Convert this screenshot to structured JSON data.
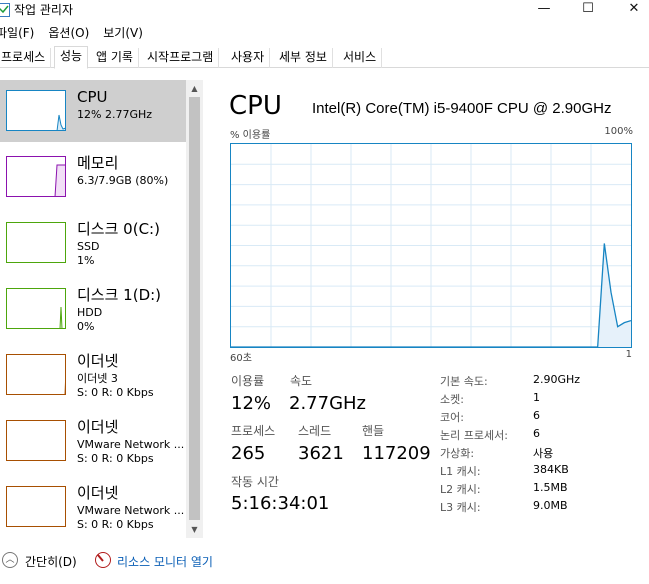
{
  "window": {
    "title": "작업 관리자",
    "minimize": "—",
    "maximize": "☐",
    "close": "✕"
  },
  "menu": [
    "파일(F)",
    "옵션(O)",
    "보기(V)"
  ],
  "tabs": [
    "프로세스",
    "성능",
    "앱 기록",
    "시작프로그램",
    "사용자",
    "세부 정보",
    "서비스"
  ],
  "active_tab": "성능",
  "sidebar": [
    {
      "title": "CPU",
      "lines": [
        "12% 2.77GHz"
      ],
      "color": "#1785c3"
    },
    {
      "title": "메모리",
      "lines": [
        "6.3/7.9GB (80%)"
      ],
      "color": "#8b12ae"
    },
    {
      "title": "디스크 0(C:)",
      "lines": [
        "SSD",
        "1%"
      ],
      "color": "#4da60c"
    },
    {
      "title": "디스크 1(D:)",
      "lines": [
        "HDD",
        "0%"
      ],
      "color": "#4da60c"
    },
    {
      "title": "이더넷",
      "lines": [
        "이더넷 3",
        "S: 0 R: 0 Kbps"
      ],
      "color": "#a74f01"
    },
    {
      "title": "이더넷",
      "lines": [
        "VMware Network ...",
        "S: 0 R: 0 Kbps"
      ],
      "color": "#a74f01"
    },
    {
      "title": "이더넷",
      "lines": [
        "VMware Network ...",
        "S: 0 R: 0 Kbps"
      ],
      "color": "#a74f01"
    }
  ],
  "main": {
    "title": "CPU",
    "model": "Intel(R) Core(TM) i5-9400F CPU @ 2.90GHz",
    "axis_top_left": "% 이용률",
    "axis_top_right": "100%",
    "axis_bottom_left": "60초",
    "axis_bottom_right": "1"
  },
  "chart_data": {
    "type": "area",
    "ylim": [
      0,
      100
    ],
    "x": [
      0,
      1,
      2,
      3,
      4,
      5,
      6,
      7,
      8,
      9,
      10,
      11,
      12,
      13,
      14,
      15,
      16,
      17,
      18,
      19,
      20,
      21,
      22,
      23,
      24,
      25,
      26,
      27,
      28,
      29,
      30,
      31,
      32,
      33,
      34,
      35,
      36,
      37,
      38,
      39,
      40,
      41,
      42,
      43,
      44,
      45,
      46,
      47,
      48,
      49,
      50,
      51,
      52,
      53,
      54,
      55,
      56,
      57,
      58,
      59,
      60
    ],
    "values": [
      0,
      0,
      0,
      0,
      0,
      0,
      0,
      0,
      0,
      0,
      0,
      0,
      0,
      0,
      0,
      0,
      0,
      0,
      0,
      0,
      0,
      0,
      0,
      0,
      0,
      0,
      0,
      0,
      0,
      0,
      0,
      0,
      0,
      0,
      0,
      0,
      0,
      0,
      0,
      0,
      0,
      0,
      0,
      0,
      0,
      0,
      0,
      0,
      0,
      0,
      0,
      0,
      0,
      0,
      0,
      0,
      51,
      27,
      10,
      12,
      13
    ],
    "grid": true,
    "color": "#1785c3"
  },
  "stats": {
    "util_label": "이용률",
    "util_value": "12%",
    "speed_label": "속도",
    "speed_value": "2.77GHz",
    "proc_label": "프로세스",
    "proc_value": "265",
    "thread_label": "스레드",
    "thread_value": "3621",
    "handle_label": "핸들",
    "handle_value": "117209",
    "uptime_label": "작동 시간",
    "uptime_value": "5:16:34:01"
  },
  "specs": [
    {
      "label": "기본 속도:",
      "value": "2.90GHz"
    },
    {
      "label": "소켓:",
      "value": "1"
    },
    {
      "label": "코어:",
      "value": "6"
    },
    {
      "label": "논리 프로세서:",
      "value": "6"
    },
    {
      "label": "가상화:",
      "value": "사용"
    },
    {
      "label": "L1 캐시:",
      "value": "384KB"
    },
    {
      "label": "L2 캐시:",
      "value": "1.5MB"
    },
    {
      "label": "L3 캐시:",
      "value": "9.0MB"
    }
  ],
  "footer": {
    "fewer_details": "간단히(D)",
    "fewer_icon": "chevron-up-icon",
    "open_monitor": "리소스 모니터 열기",
    "monitor_icon": "resource-monitor-icon"
  }
}
